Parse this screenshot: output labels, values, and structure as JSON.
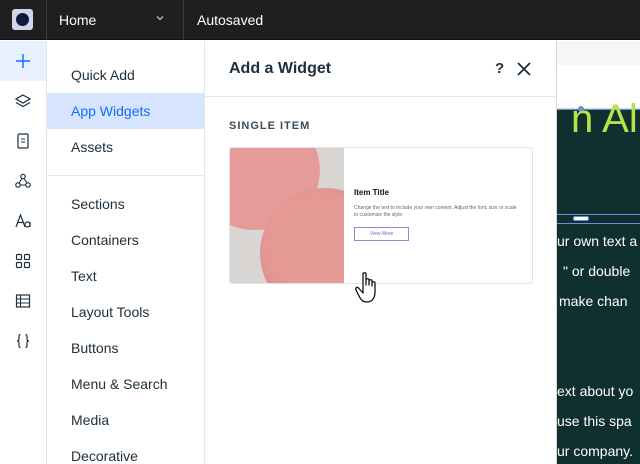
{
  "topbar": {
    "page_name": "Home",
    "status": "Autosaved"
  },
  "rail": {
    "icons": [
      "plus-icon",
      "layers-icon",
      "page-icon",
      "connect-icon",
      "text-theme-icon",
      "apps-grid-icon",
      "table-icon",
      "code-braces-icon"
    ]
  },
  "categories": {
    "group1": [
      "Quick Add",
      "App Widgets",
      "Assets"
    ],
    "group2": [
      "Sections",
      "Containers",
      "Text",
      "Layout Tools",
      "Buttons",
      "Menu & Search",
      "Media",
      "Decorative"
    ],
    "active": "App Widgets"
  },
  "panel": {
    "title": "Add a Widget",
    "help": "?",
    "section_label": "SINGLE ITEM",
    "card": {
      "title": "Item Title",
      "text": "Change the text to include your own content. Adjust the font, size or scale to customize the style.",
      "button": "View More"
    }
  },
  "canvas": {
    "heading": "n All",
    "lines": [
      "ur own text a",
      "\" or double",
      " make chan",
      "ext about yo",
      "use this spa",
      "ur company."
    ]
  },
  "colors": {
    "accent": "#116dff",
    "active_bg": "#d6e4fe",
    "topbar_bg": "#1f1f1f",
    "canvas_bg": "#10302f",
    "canvas_heading": "#b8e24a"
  }
}
